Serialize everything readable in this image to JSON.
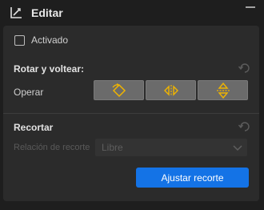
{
  "header": {
    "title": "Editar",
    "icon": "edit-crop-icon",
    "collapse_icon": "minimize-icon"
  },
  "enabled": {
    "label": "Activado",
    "checked": false
  },
  "rotate_flip": {
    "title": "Rotar y voltear:",
    "operate_label": "Operar",
    "buttons": [
      "rotate-icon",
      "flip-horizontal-icon",
      "flip-vertical-icon"
    ],
    "icon_color": "#f0b400"
  },
  "crop": {
    "title": "Recortar",
    "ratio_label": "Relación de recorte",
    "ratio_value": "Libre",
    "apply_label": "Ajustar recorte"
  },
  "colors": {
    "accent": "#1473e6",
    "panel": "#2b2b2b",
    "background": "#1e1e1e"
  }
}
